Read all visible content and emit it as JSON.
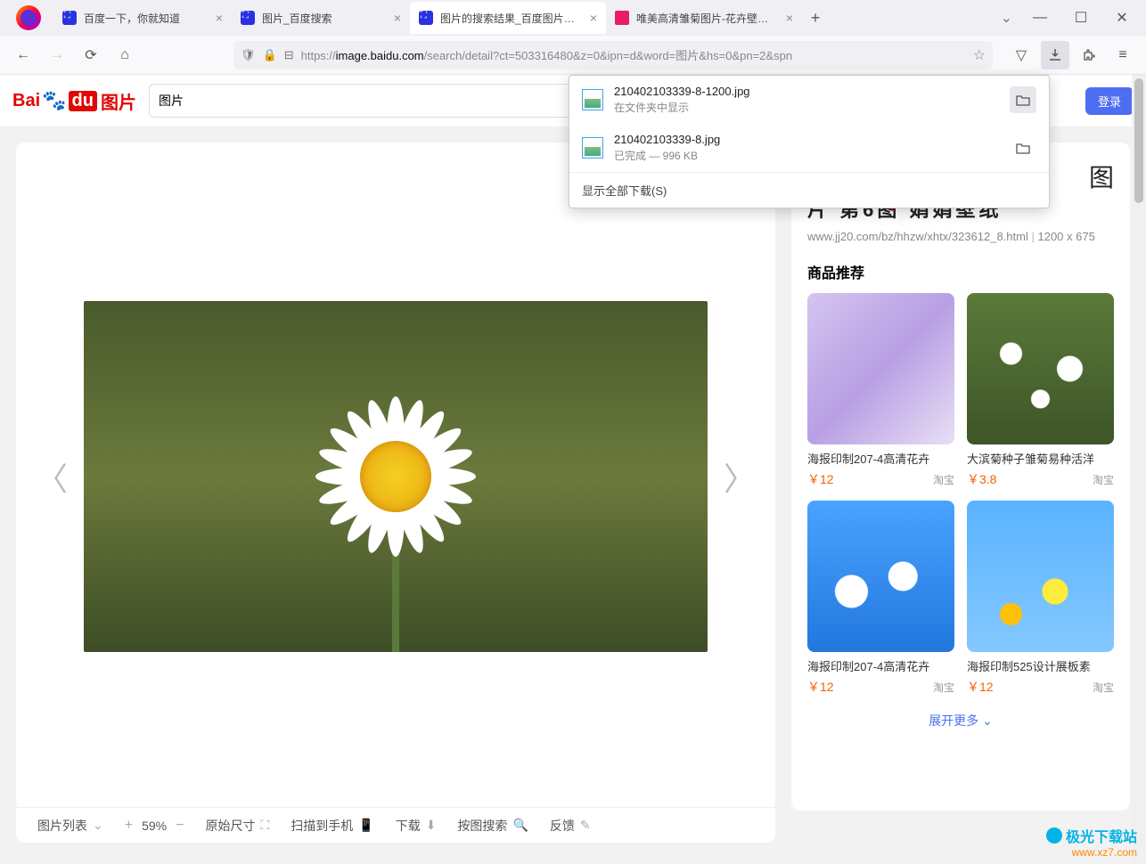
{
  "tabs": [
    {
      "title": "百度一下，你就知道"
    },
    {
      "title": "图片_百度搜索"
    },
    {
      "title": "图片的搜索结果_百度图片搜索"
    },
    {
      "title": "唯美高清雏菊图片-花卉壁纸-高"
    }
  ],
  "url": {
    "prefix": "https://",
    "domain": "image.baidu.com",
    "path": "/search/detail?ct=503316480&z=0&ipn=d&word=图片&hs=0&pn=2&spn"
  },
  "downloads": {
    "items": [
      {
        "name": "210402103339-8-1200.jpg",
        "sub": "在文件夹中显示"
      },
      {
        "name": "210402103339-8.jpg",
        "sub": "已完成 — 996 KB"
      }
    ],
    "footer": "显示全部下载(S)"
  },
  "search": {
    "value": "图片"
  },
  "login": "登录",
  "sidebar": {
    "title_partial": "片 第6图 娟娟壁纸",
    "tu_char": "图",
    "src_url": "www.jj20.com/bz/hhzw/xhtx/323612_8.html",
    "dims": "1200 x 675",
    "rec_title": "商品推荐",
    "recs": [
      {
        "name": "海报印制207-4高清花卉",
        "price": "￥12",
        "src": "淘宝"
      },
      {
        "name": "大滨菊种子雏菊易种活洋",
        "price": "￥3.8",
        "src": "淘宝"
      },
      {
        "name": "海报印制207-4高清花卉",
        "price": "￥12",
        "src": "淘宝"
      },
      {
        "name": "海报印制525设计展板素",
        "price": "￥12",
        "src": "淘宝"
      }
    ],
    "expand": "展开更多"
  },
  "toolbar": {
    "list": "图片列表",
    "zoom": "59%",
    "orig": "原始尺寸",
    "scan": "扫描到手机",
    "download": "下载",
    "search_by_img": "按图搜索",
    "feedback": "反馈"
  },
  "watermark": {
    "name": "极光下载站",
    "url": "www.xz7.com"
  }
}
